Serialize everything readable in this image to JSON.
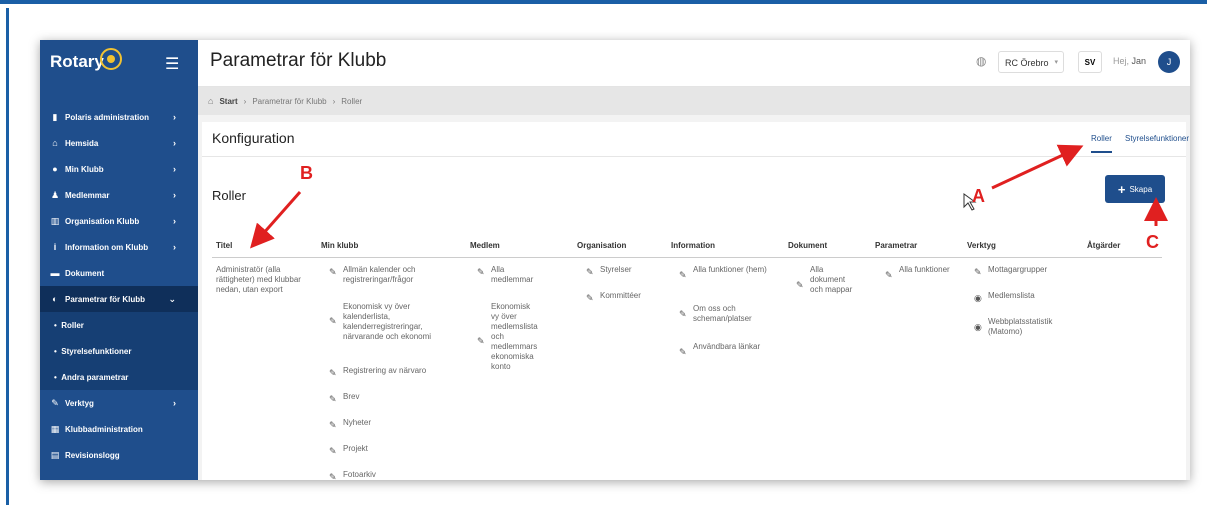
{
  "app": {
    "logo_text": "Rotary",
    "page_title": "Parametrar för Klubb",
    "club": "RC Örebro",
    "language": "SV",
    "greeting": "Hej,",
    "user_name": "Jan",
    "avatar_initial": "J"
  },
  "sidebar": {
    "items": [
      {
        "label": "Polaris administration",
        "icon": "clipboard-icon"
      },
      {
        "label": "Hemsida",
        "icon": "home-icon"
      },
      {
        "label": "Min Klubb",
        "icon": "globe-icon"
      },
      {
        "label": "Medlemmar",
        "icon": "user-icon"
      },
      {
        "label": "Organisation Klubb",
        "icon": "building-icon"
      },
      {
        "label": "Information om Klubb",
        "icon": "info-icon"
      },
      {
        "label": "Dokument",
        "icon": "folder-icon"
      },
      {
        "label": "Parametrar för Klubb",
        "icon": "toggle-icon"
      }
    ],
    "subitems": [
      "Roller",
      "Styrelsefunktioner",
      "Andra parametrar"
    ],
    "bottom_items": [
      {
        "label": "Verktyg",
        "icon": "wrench-icon"
      },
      {
        "label": "Klubbadministration",
        "icon": "org-icon"
      },
      {
        "label": "Revisionslogg",
        "icon": "file-icon"
      }
    ]
  },
  "breadcrumb": [
    "Start",
    "Parametrar för Klubb",
    "Roller"
  ],
  "card": {
    "title": "Konfiguration",
    "tabs": [
      "Roller",
      "Styrelsefunktioner"
    ],
    "section_title": "Roller",
    "create_button": "Skapa"
  },
  "table": {
    "headers": [
      "Titel",
      "Min klubb",
      "Medlem",
      "Organisation",
      "Information",
      "Dokument",
      "Parametrar",
      "Verktyg",
      "Åtgärder"
    ],
    "row": {
      "title": "Administratör (alla rättigheter) med klubbar nedan, utan export",
      "min_klubb": [
        "Allmän kalender och registreringar/frågor",
        "Ekonomisk vy över kalenderlista, kalenderregistreringar, närvarande och ekonomi",
        "Registrering av närvaro",
        "Brev",
        "Nyheter",
        "Projekt",
        "Fotoarkiv"
      ],
      "medlem": [
        "Alla medlemmar",
        "Ekonomisk vy över medlemslista och medlemmars ekonomiska konto"
      ],
      "organisation": [
        "Styrelser",
        "Kommittéer"
      ],
      "information": [
        "Alla funktioner (hem)",
        "Om oss och scheman/platser",
        "Användbara länkar"
      ],
      "dokument": [
        "Alla dokument och mappar"
      ],
      "parametrar": [
        "Alla funktioner"
      ],
      "verktyg": [
        "Mottagargrupper",
        "Medlemslista",
        "Webbplatsstatistik (Matomo)"
      ]
    }
  },
  "annotations": [
    "A",
    "B",
    "C"
  ],
  "colors": {
    "brand": "#1f4e8c",
    "annotation": "#e02020"
  }
}
